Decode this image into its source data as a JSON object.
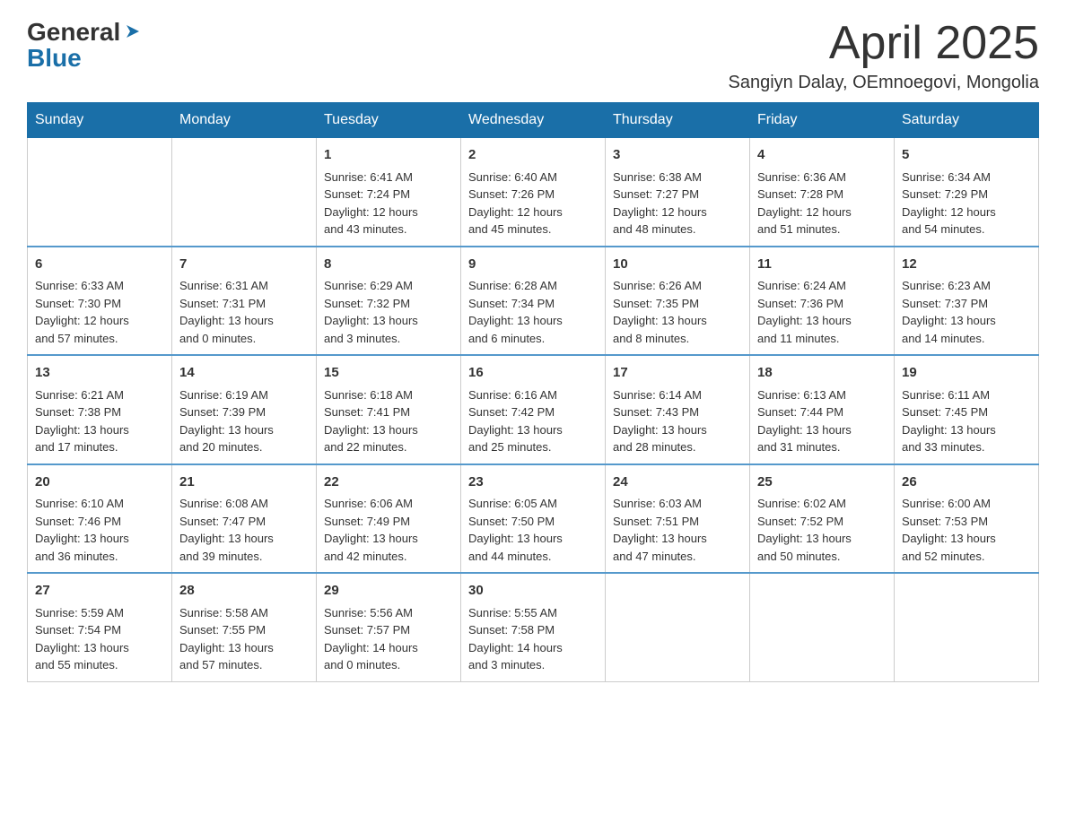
{
  "header": {
    "logo": {
      "general": "General",
      "blue": "Blue",
      "arrow": "▶"
    },
    "title": "April 2025",
    "location": "Sangiyn Dalay, OEmnoegovi, Mongolia"
  },
  "weekdays": [
    "Sunday",
    "Monday",
    "Tuesday",
    "Wednesday",
    "Thursday",
    "Friday",
    "Saturday"
  ],
  "weeks": [
    [
      {
        "day": "",
        "info": ""
      },
      {
        "day": "",
        "info": ""
      },
      {
        "day": "1",
        "info": "Sunrise: 6:41 AM\nSunset: 7:24 PM\nDaylight: 12 hours\nand 43 minutes."
      },
      {
        "day": "2",
        "info": "Sunrise: 6:40 AM\nSunset: 7:26 PM\nDaylight: 12 hours\nand 45 minutes."
      },
      {
        "day": "3",
        "info": "Sunrise: 6:38 AM\nSunset: 7:27 PM\nDaylight: 12 hours\nand 48 minutes."
      },
      {
        "day": "4",
        "info": "Sunrise: 6:36 AM\nSunset: 7:28 PM\nDaylight: 12 hours\nand 51 minutes."
      },
      {
        "day": "5",
        "info": "Sunrise: 6:34 AM\nSunset: 7:29 PM\nDaylight: 12 hours\nand 54 minutes."
      }
    ],
    [
      {
        "day": "6",
        "info": "Sunrise: 6:33 AM\nSunset: 7:30 PM\nDaylight: 12 hours\nand 57 minutes."
      },
      {
        "day": "7",
        "info": "Sunrise: 6:31 AM\nSunset: 7:31 PM\nDaylight: 13 hours\nand 0 minutes."
      },
      {
        "day": "8",
        "info": "Sunrise: 6:29 AM\nSunset: 7:32 PM\nDaylight: 13 hours\nand 3 minutes."
      },
      {
        "day": "9",
        "info": "Sunrise: 6:28 AM\nSunset: 7:34 PM\nDaylight: 13 hours\nand 6 minutes."
      },
      {
        "day": "10",
        "info": "Sunrise: 6:26 AM\nSunset: 7:35 PM\nDaylight: 13 hours\nand 8 minutes."
      },
      {
        "day": "11",
        "info": "Sunrise: 6:24 AM\nSunset: 7:36 PM\nDaylight: 13 hours\nand 11 minutes."
      },
      {
        "day": "12",
        "info": "Sunrise: 6:23 AM\nSunset: 7:37 PM\nDaylight: 13 hours\nand 14 minutes."
      }
    ],
    [
      {
        "day": "13",
        "info": "Sunrise: 6:21 AM\nSunset: 7:38 PM\nDaylight: 13 hours\nand 17 minutes."
      },
      {
        "day": "14",
        "info": "Sunrise: 6:19 AM\nSunset: 7:39 PM\nDaylight: 13 hours\nand 20 minutes."
      },
      {
        "day": "15",
        "info": "Sunrise: 6:18 AM\nSunset: 7:41 PM\nDaylight: 13 hours\nand 22 minutes."
      },
      {
        "day": "16",
        "info": "Sunrise: 6:16 AM\nSunset: 7:42 PM\nDaylight: 13 hours\nand 25 minutes."
      },
      {
        "day": "17",
        "info": "Sunrise: 6:14 AM\nSunset: 7:43 PM\nDaylight: 13 hours\nand 28 minutes."
      },
      {
        "day": "18",
        "info": "Sunrise: 6:13 AM\nSunset: 7:44 PM\nDaylight: 13 hours\nand 31 minutes."
      },
      {
        "day": "19",
        "info": "Sunrise: 6:11 AM\nSunset: 7:45 PM\nDaylight: 13 hours\nand 33 minutes."
      }
    ],
    [
      {
        "day": "20",
        "info": "Sunrise: 6:10 AM\nSunset: 7:46 PM\nDaylight: 13 hours\nand 36 minutes."
      },
      {
        "day": "21",
        "info": "Sunrise: 6:08 AM\nSunset: 7:47 PM\nDaylight: 13 hours\nand 39 minutes."
      },
      {
        "day": "22",
        "info": "Sunrise: 6:06 AM\nSunset: 7:49 PM\nDaylight: 13 hours\nand 42 minutes."
      },
      {
        "day": "23",
        "info": "Sunrise: 6:05 AM\nSunset: 7:50 PM\nDaylight: 13 hours\nand 44 minutes."
      },
      {
        "day": "24",
        "info": "Sunrise: 6:03 AM\nSunset: 7:51 PM\nDaylight: 13 hours\nand 47 minutes."
      },
      {
        "day": "25",
        "info": "Sunrise: 6:02 AM\nSunset: 7:52 PM\nDaylight: 13 hours\nand 50 minutes."
      },
      {
        "day": "26",
        "info": "Sunrise: 6:00 AM\nSunset: 7:53 PM\nDaylight: 13 hours\nand 52 minutes."
      }
    ],
    [
      {
        "day": "27",
        "info": "Sunrise: 5:59 AM\nSunset: 7:54 PM\nDaylight: 13 hours\nand 55 minutes."
      },
      {
        "day": "28",
        "info": "Sunrise: 5:58 AM\nSunset: 7:55 PM\nDaylight: 13 hours\nand 57 minutes."
      },
      {
        "day": "29",
        "info": "Sunrise: 5:56 AM\nSunset: 7:57 PM\nDaylight: 14 hours\nand 0 minutes."
      },
      {
        "day": "30",
        "info": "Sunrise: 5:55 AM\nSunset: 7:58 PM\nDaylight: 14 hours\nand 3 minutes."
      },
      {
        "day": "",
        "info": ""
      },
      {
        "day": "",
        "info": ""
      },
      {
        "day": "",
        "info": ""
      }
    ]
  ]
}
